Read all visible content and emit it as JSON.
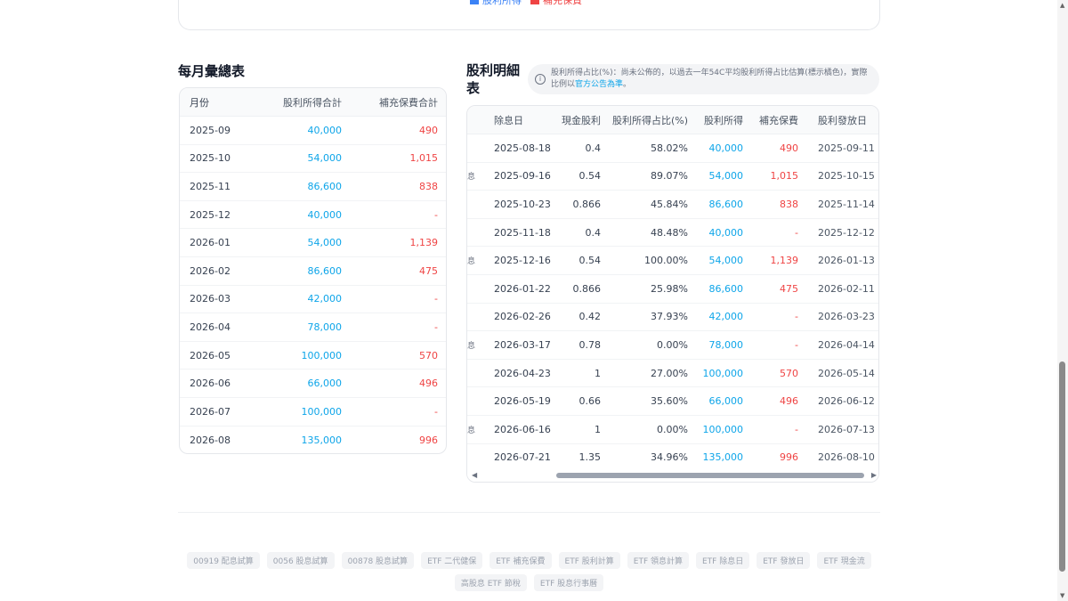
{
  "legend": [
    {
      "label": "股利所得",
      "color": "#3b82f6"
    },
    {
      "label": "補充保費",
      "color": "#ef4444"
    }
  ],
  "monthly": {
    "title": "每月彙總表",
    "headers": [
      "月份",
      "股利所得合計",
      "補充保費合計"
    ],
    "rows": [
      [
        "2025-09",
        "40,000",
        "490"
      ],
      [
        "2025-10",
        "54,000",
        "1,015"
      ],
      [
        "2025-11",
        "86,600",
        "838"
      ],
      [
        "2025-12",
        "40,000",
        "-"
      ],
      [
        "2026-01",
        "54,000",
        "1,139"
      ],
      [
        "2026-02",
        "86,600",
        "475"
      ],
      [
        "2026-03",
        "42,000",
        "-"
      ],
      [
        "2026-04",
        "78,000",
        "-"
      ],
      [
        "2026-05",
        "100,000",
        "570"
      ],
      [
        "2026-06",
        "66,000",
        "496"
      ],
      [
        "2026-07",
        "100,000",
        "-"
      ],
      [
        "2026-08",
        "135,000",
        "996"
      ]
    ]
  },
  "detail": {
    "title_line1": "股利明細",
    "title_line2": "表",
    "note_text": "股利所得占比(%)：尚未公佈的，以過去一年54C平均股利所得占比估算(標示橘色)，實際比例以",
    "note_link": "官方公告為準",
    "note_end": "。",
    "headers": [
      "除息日",
      "現金股利",
      "股利所得占比(%)",
      "股利所得",
      "補充保費",
      "股利發放日"
    ],
    "rows": [
      {
        "prefix": "",
        "cells": [
          "2025-08-18",
          "0.4",
          "58.02%",
          "40,000",
          "490",
          "2025-09-11"
        ]
      },
      {
        "prefix": "息",
        "cells": [
          "2025-09-16",
          "0.54",
          "89.07%",
          "54,000",
          "1,015",
          "2025-10-15"
        ]
      },
      {
        "prefix": "",
        "cells": [
          "2025-10-23",
          "0.866",
          "45.84%",
          "86,600",
          "838",
          "2025-11-14"
        ]
      },
      {
        "prefix": "",
        "cells": [
          "2025-11-18",
          "0.4",
          "48.48%",
          "40,000",
          "-",
          "2025-12-12"
        ]
      },
      {
        "prefix": "息",
        "cells": [
          "2025-12-16",
          "0.54",
          "100.00%",
          "54,000",
          "1,139",
          "2026-01-13"
        ]
      },
      {
        "prefix": "",
        "cells": [
          "2026-01-22",
          "0.866",
          "25.98%",
          "86,600",
          "475",
          "2026-02-11"
        ]
      },
      {
        "prefix": "",
        "cells": [
          "2026-02-26",
          "0.42",
          "37.93%",
          "42,000",
          "-",
          "2026-03-23"
        ]
      },
      {
        "prefix": "息",
        "cells": [
          "2026-03-17",
          "0.78",
          "0.00%",
          "78,000",
          "-",
          "2026-04-14"
        ]
      },
      {
        "prefix": "",
        "cells": [
          "2026-04-23",
          "1",
          "27.00%",
          "100,000",
          "570",
          "2026-05-14"
        ]
      },
      {
        "prefix": "",
        "cells": [
          "2026-05-19",
          "0.66",
          "35.60%",
          "66,000",
          "496",
          "2026-06-12"
        ]
      },
      {
        "prefix": "息",
        "cells": [
          "2026-06-16",
          "1",
          "0.00%",
          "100,000",
          "-",
          "2026-07-13"
        ]
      },
      {
        "prefix": "",
        "cells": [
          "2026-07-21",
          "1.35",
          "34.96%",
          "135,000",
          "996",
          "2026-08-10"
        ]
      }
    ]
  },
  "footer_tags": [
    "00919 配息試算",
    "0056 股息試算",
    "00878 股息試算",
    "ETF 二代健保",
    "ETF 補充保費",
    "ETF 股利計算",
    "ETF 領息計算",
    "ETF 除息日",
    "ETF 發放日",
    "ETF 現金流",
    "高股息 ETF 節稅",
    "ETF 股息行事曆"
  ],
  "colors": {
    "income": "#0ea5e9",
    "premium": "#ef4444"
  }
}
